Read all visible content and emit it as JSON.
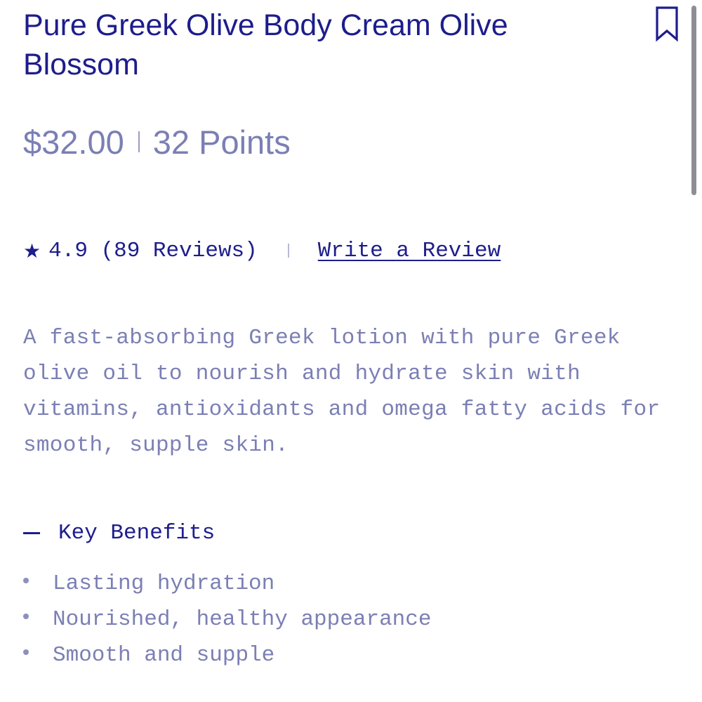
{
  "product": {
    "title": "Pure Greek Olive Body Cream Olive Blossom",
    "price": "$32.00",
    "points": "32 Points"
  },
  "rating": {
    "star_icon": "star-icon",
    "text": "4.9 (89 Reviews)",
    "write_review_label": "Write a Review"
  },
  "description": "A fast-absorbing Greek lotion with pure Greek olive oil to nourish and hydrate skin with vitamins, antioxidants and omega fatty acids for smooth, supple skin.",
  "benefits": {
    "header": "Key Benefits",
    "items": [
      "Lasting hydration",
      "Nourished, healthy appearance",
      "Smooth and supple"
    ]
  },
  "icons": {
    "bookmark": "bookmark-icon",
    "collapse": "minus-icon"
  },
  "colors": {
    "primary": "#1d1d8c",
    "muted": "#7b7fb4",
    "background": "#ffffff"
  }
}
